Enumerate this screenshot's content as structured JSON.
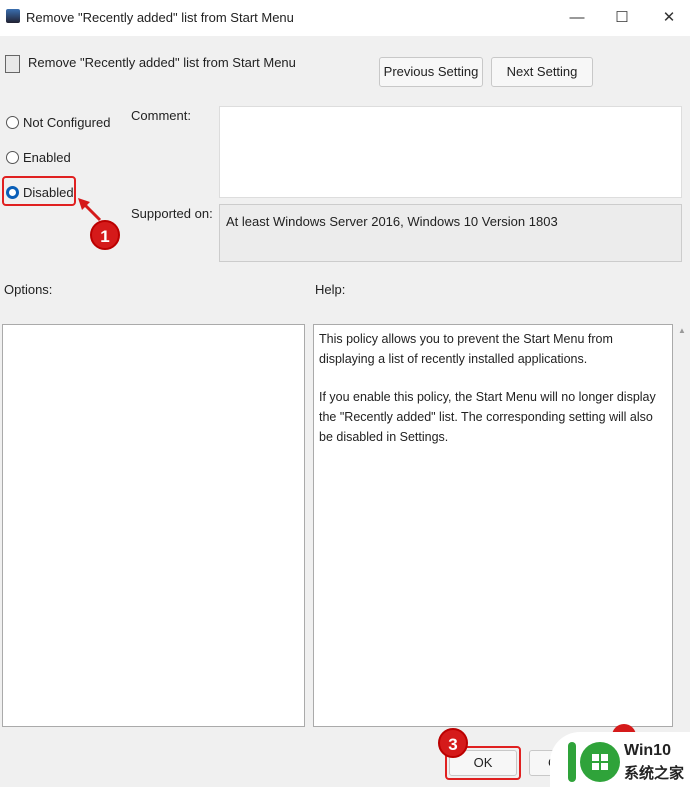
{
  "window": {
    "title": "Remove \"Recently added\" list from Start Menu",
    "minimize": "—",
    "maximize": "☐",
    "close": "✕"
  },
  "header": {
    "policy_name": "Remove \"Recently added\" list from Start Menu",
    "prev_label": "Previous Setting",
    "next_label": "Next Setting"
  },
  "state": {
    "options": [
      {
        "label": "Not Configured",
        "selected": false
      },
      {
        "label": "Enabled",
        "selected": false
      },
      {
        "label": "Disabled",
        "selected": true
      }
    ]
  },
  "comment": {
    "label": "Comment:",
    "value": ""
  },
  "supported": {
    "label": "Supported on:",
    "value": "At least Windows Server 2016, Windows 10 Version 1803"
  },
  "options_label": "Options:",
  "help_label": "Help:",
  "help": {
    "paragraphs": [
      "This policy allows you to prevent the Start Menu from displaying a list of recently installed applications.",
      "If you enable this policy, the Start Menu will no longer display the \"Recently added\" list.  The corresponding setting will also be disabled in Settings."
    ]
  },
  "footer": {
    "ok_label": "OK",
    "cancel_partial": "C"
  },
  "annotations": {
    "step1": "1",
    "step3": "3",
    "color": "#d51a1a"
  },
  "watermark": {
    "line1": "Win10",
    "line2": "系统之家"
  }
}
